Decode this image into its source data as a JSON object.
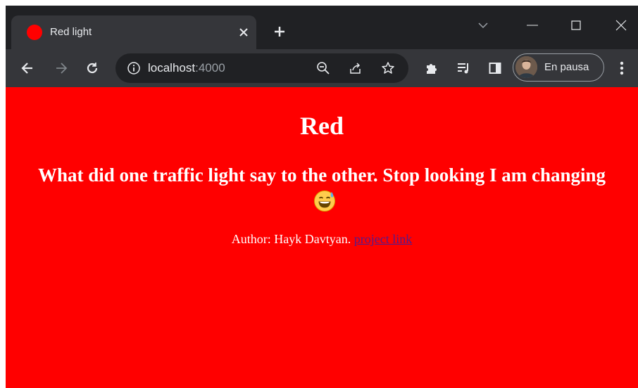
{
  "browser": {
    "tab": {
      "title": "Red light",
      "favicon_color": "#ff0000"
    },
    "address": {
      "host": "localhost",
      "port": ":4000"
    },
    "profile": {
      "label": "En pausa"
    }
  },
  "page": {
    "background": "#ff0000",
    "heading": "Red",
    "joke": "What did one traffic light say to the other. Stop looking I am changing",
    "emoji": "grinning-face-with-sweat",
    "author": "Author: Hayk Davtyan.",
    "link_text": "project link"
  }
}
